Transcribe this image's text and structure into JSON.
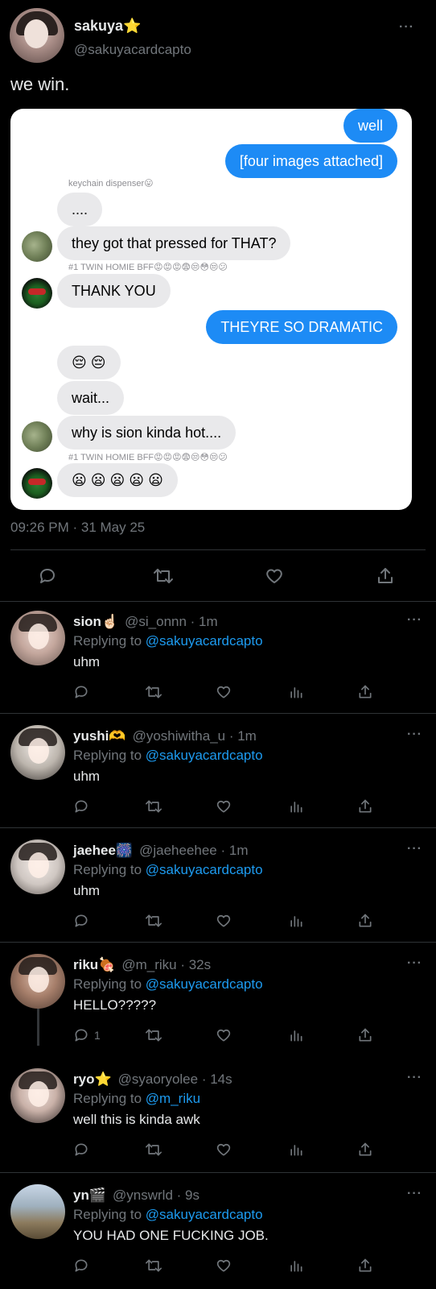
{
  "tweet": {
    "name": "sakuya⭐",
    "handle": "@sakuyacardcapto",
    "text": "we win.",
    "timestamp": "09:26 PM · 31 May 25",
    "more": "···"
  },
  "chat": {
    "messages": [
      {
        "dir": "out",
        "text": "well"
      },
      {
        "dir": "out",
        "text": "[four images attached]"
      },
      {
        "dir": "label",
        "text": "keychain dispenser😛"
      },
      {
        "dir": "in",
        "text": "...."
      },
      {
        "dir": "in",
        "text": "they got that pressed for THAT?",
        "avatar": "nature-avatar"
      },
      {
        "dir": "label",
        "text": "#1 TWIN HOMIE BFF😡😡😡😨😒😳😒😕"
      },
      {
        "dir": "in",
        "text": "THANK YOU",
        "avatar": "mask-avatar"
      },
      {
        "dir": "out",
        "text": "THEYRE SO DRAMATIC"
      },
      {
        "dir": "in",
        "text": "😔 😔"
      },
      {
        "dir": "in",
        "text": "wait..."
      },
      {
        "dir": "in",
        "text": "why is sion kinda hot....",
        "avatar": "nature-avatar"
      },
      {
        "dir": "label",
        "text": "#1 TWIN HOMIE BFF😡😡😡😨😒😳😒😕"
      },
      {
        "dir": "in",
        "text": "😦 😦 😦 😦 😦",
        "avatar": "mask-avatar"
      }
    ]
  },
  "actions": {
    "icons": [
      "reply-icon",
      "retweet-icon",
      "like-icon",
      "share-icon"
    ],
    "reply_icons": [
      "reply-icon",
      "retweet-icon",
      "like-icon",
      "views-icon",
      "share-icon"
    ]
  },
  "replies": [
    {
      "name": "sion☝🏻",
      "handle": "@si_onnn · 1m",
      "replying_prefix": "Replying to ",
      "replying_to": "@sakuyacardcapto",
      "text": "uhm",
      "reply_count": ""
    },
    {
      "name": "yushi🫶",
      "handle": "@yoshiwitha_u · 1m",
      "replying_prefix": "Replying to ",
      "replying_to": "@sakuyacardcapto",
      "text": "uhm",
      "reply_count": ""
    },
    {
      "name": "jaehee🎆",
      "handle": "@jaeheehee · 1m",
      "replying_prefix": "Replying to ",
      "replying_to": "@sakuyacardcapto",
      "text": "uhm",
      "reply_count": ""
    },
    {
      "name": "riku🍖",
      "handle": "@m_riku · 32s",
      "replying_prefix": "Replying to ",
      "replying_to": "@sakuyacardcapto",
      "text": "HELLO?????",
      "reply_count": "1"
    },
    {
      "name": "ryo⭐",
      "handle": "@syaoryolee · 14s",
      "replying_prefix": "Replying to ",
      "replying_to": "@m_riku",
      "text": "well this is kinda awk",
      "reply_count": ""
    },
    {
      "name": "yn🎬",
      "handle": "@ynswrld · 9s",
      "replying_prefix": "Replying to ",
      "replying_to": "@sakuyacardcapto",
      "text": "YOU HAD ONE FUCKING JOB.",
      "reply_count": ""
    }
  ]
}
